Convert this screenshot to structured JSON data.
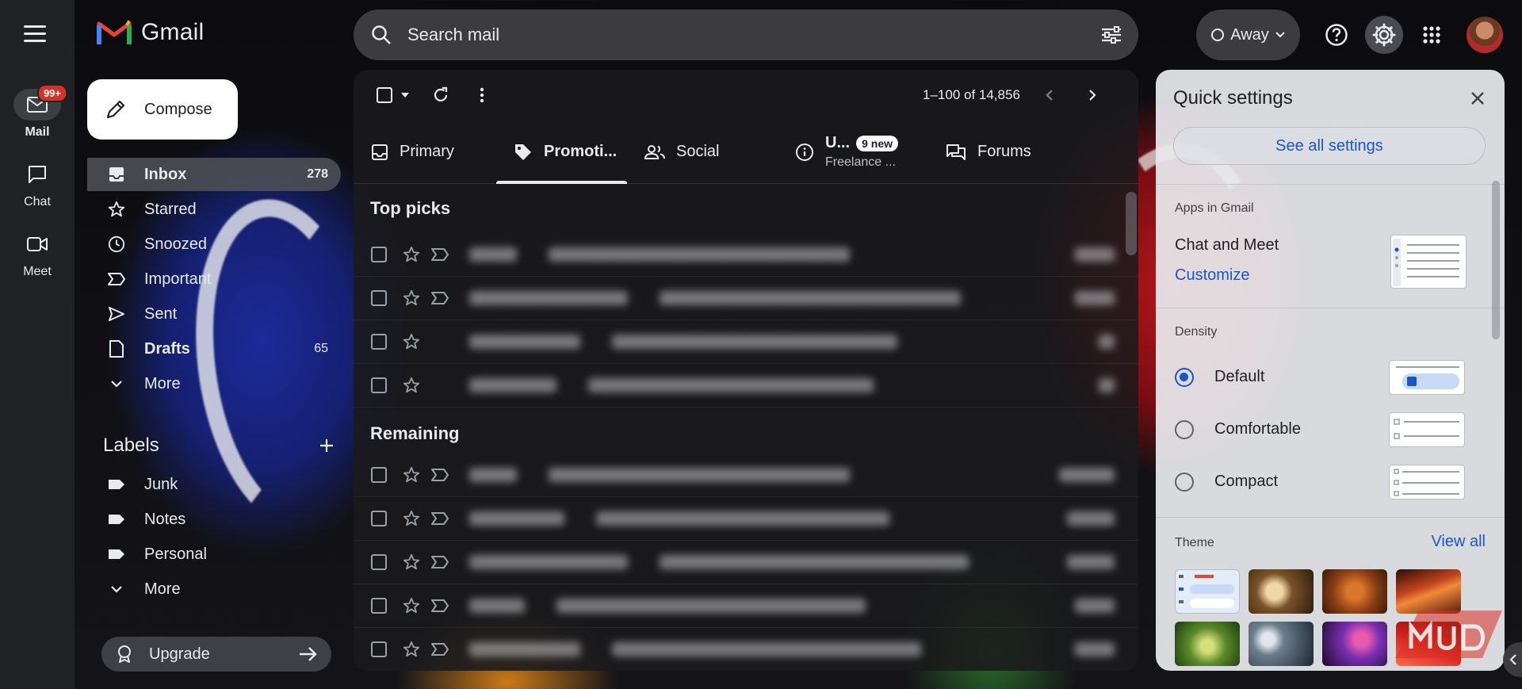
{
  "app": {
    "brand": "Gmail"
  },
  "rail": {
    "items": [
      {
        "label": "Mail",
        "icon": "mail-icon",
        "badge": "99+"
      },
      {
        "label": "Chat",
        "icon": "chat-icon"
      },
      {
        "label": "Meet",
        "icon": "meet-icon"
      }
    ]
  },
  "compose": {
    "label": "Compose"
  },
  "nav": {
    "items": [
      {
        "label": "Inbox",
        "count": "278"
      },
      {
        "label": "Starred",
        "count": ""
      },
      {
        "label": "Snoozed",
        "count": ""
      },
      {
        "label": "Important",
        "count": ""
      },
      {
        "label": "Sent",
        "count": ""
      },
      {
        "label": "Drafts",
        "count": "65"
      },
      {
        "label": "More",
        "count": ""
      }
    ]
  },
  "labels": {
    "heading": "Labels",
    "items": [
      {
        "label": "Junk"
      },
      {
        "label": "Notes"
      },
      {
        "label": "Personal"
      },
      {
        "label": "More"
      }
    ]
  },
  "upgrade": {
    "label": "Upgrade"
  },
  "search": {
    "placeholder": "Search mail"
  },
  "status": {
    "label": "Away"
  },
  "toolbar": {
    "pager": "1–100 of 14,856"
  },
  "tabs": [
    {
      "label": "Primary",
      "icon": "inbox-tab-icon"
    },
    {
      "label": "Promoti...",
      "icon": "tag-icon"
    },
    {
      "label": "Social",
      "icon": "people-icon"
    },
    {
      "label": "U...",
      "badge": "9 new",
      "sub": "Freelance ...",
      "icon": "info-icon"
    },
    {
      "label": "Forums",
      "icon": "forum-icon"
    }
  ],
  "sections": {
    "top_picks": "Top picks",
    "remaining": "Remaining"
  },
  "quick_settings": {
    "title": "Quick settings",
    "see_all": "See all settings",
    "apps_heading": "Apps in Gmail",
    "chat_meet": "Chat and Meet",
    "customize": "Customize",
    "density_heading": "Density",
    "density_options": [
      "Default",
      "Comfortable",
      "Compact"
    ],
    "density_selected": "Default",
    "theme_heading": "Theme",
    "view_all": "View all"
  },
  "colors": {
    "accent_blue": "#1a56c9",
    "badge_red": "#d93025",
    "gmail_red": "#ea4335"
  }
}
